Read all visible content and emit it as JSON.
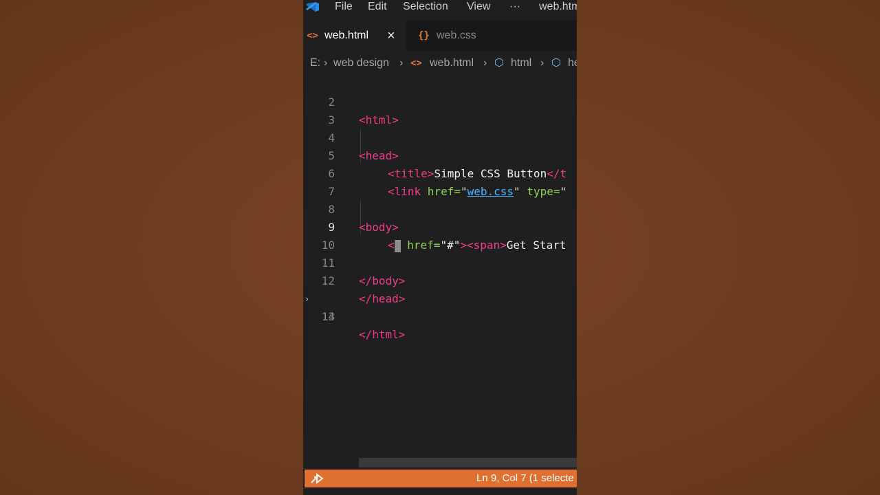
{
  "menu": {
    "items": [
      "File",
      "Edit",
      "Selection",
      "View",
      "···",
      "web.htm"
    ]
  },
  "tabs": [
    {
      "label": "web.html",
      "icon": "<>",
      "active": true
    },
    {
      "label": "web.css",
      "icon": "{}",
      "active": false
    }
  ],
  "breadcrumb": {
    "drive": "E:",
    "folder": "web design",
    "file": "web.html",
    "node1": "html",
    "node2": "he"
  },
  "code": {
    "line_numbers": [
      "2",
      "3",
      "4",
      "5",
      "6",
      "7",
      "8",
      "9",
      "10",
      "11",
      "12",
      "13",
      "14"
    ],
    "l2_tag": "<html>",
    "l4_tag": "<head>",
    "l5_open": "<title>",
    "l5_text": "Simple CSS Button",
    "l5_close": "</t",
    "l6_open": "<link",
    "l6_attr1": " href=",
    "l6_q1": "\"",
    "l6_val1": "web.css",
    "l6_q2": "\"",
    "l6_attr2": " type=",
    "l6_q3": "\"",
    "l8_tag": "<body>",
    "l9_lt": "<",
    "l9_attr": " href=",
    "l9_val": "\"#\"",
    "l9_gt": ">",
    "l9_span": "<span>",
    "l9_text": "Get Start",
    "l11_tag": "</body>",
    "l12_tag": "</head>",
    "l14_tag": "</html>"
  },
  "status": {
    "position": "Ln 9, Col 7 (1 selecte"
  },
  "colors": {
    "accent": "#e0702f",
    "tag": "#f03e8a",
    "attribute": "#8fd154",
    "link": "#46b4ff"
  }
}
